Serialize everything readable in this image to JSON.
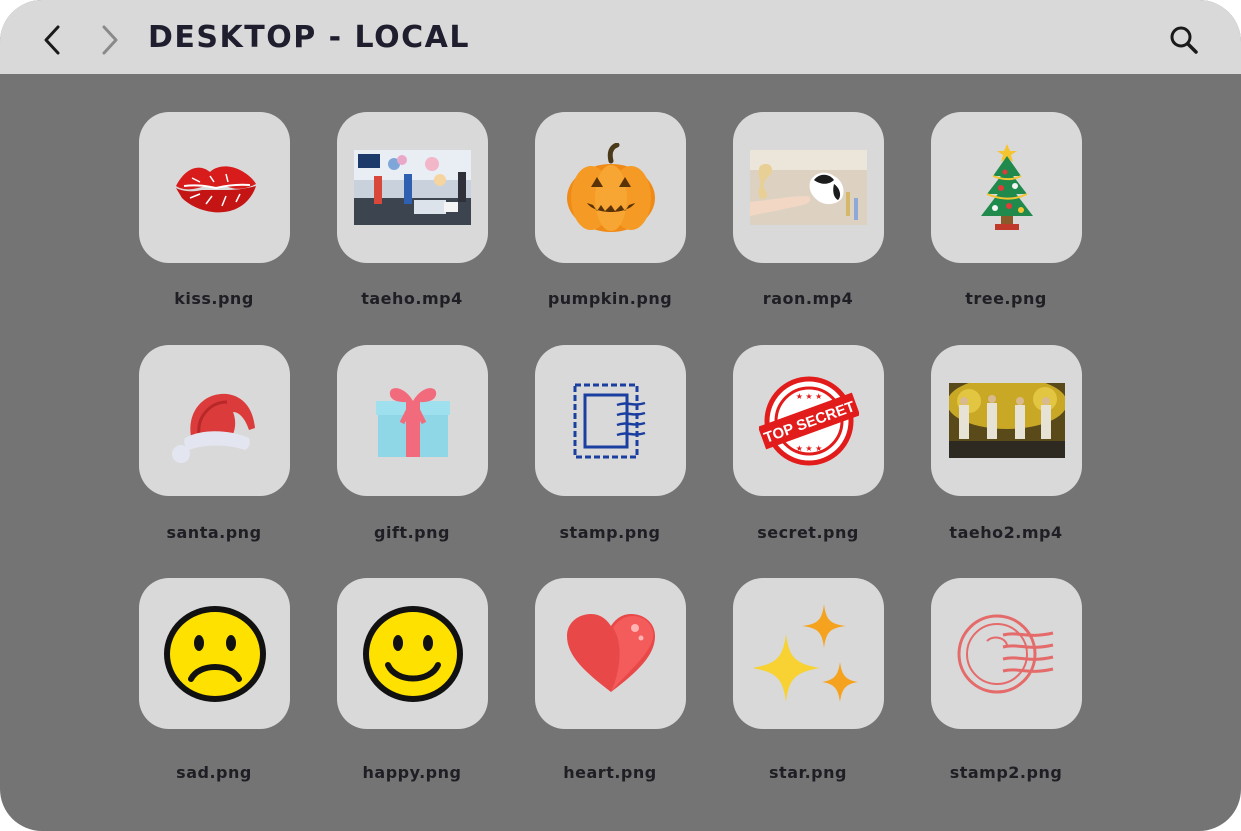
{
  "header": {
    "title": "DESKTOP - LOCAL"
  },
  "files": [
    {
      "name": "kiss.png",
      "icon": "kiss-icon"
    },
    {
      "name": "taeho.mp4",
      "icon": "video-thumbnail-icon"
    },
    {
      "name": "pumpkin.png",
      "icon": "pumpkin-icon"
    },
    {
      "name": "raon.mp4",
      "icon": "video-thumbnail-icon"
    },
    {
      "name": "tree.png",
      "icon": "christmas-tree-icon"
    },
    {
      "name": "santa.png",
      "icon": "santa-hat-icon"
    },
    {
      "name": "gift.png",
      "icon": "gift-icon"
    },
    {
      "name": "stamp.png",
      "icon": "postage-stamp-icon"
    },
    {
      "name": "secret.png",
      "icon": "top-secret-stamp-icon"
    },
    {
      "name": "taeho2.mp4",
      "icon": "video-thumbnail-icon"
    },
    {
      "name": "sad.png",
      "icon": "sad-face-icon"
    },
    {
      "name": "happy.png",
      "icon": "happy-face-icon"
    },
    {
      "name": "heart.png",
      "icon": "heart-icon"
    },
    {
      "name": "star.png",
      "icon": "sparkle-stars-icon"
    },
    {
      "name": "stamp2.png",
      "icon": "postmark-icon"
    }
  ],
  "secret_stamp_text": "TOP SECRET",
  "colors": {
    "header": "#d9d9d9",
    "background": "#747474",
    "tile": "#d9d9d9",
    "title": "#1e1e2e"
  }
}
